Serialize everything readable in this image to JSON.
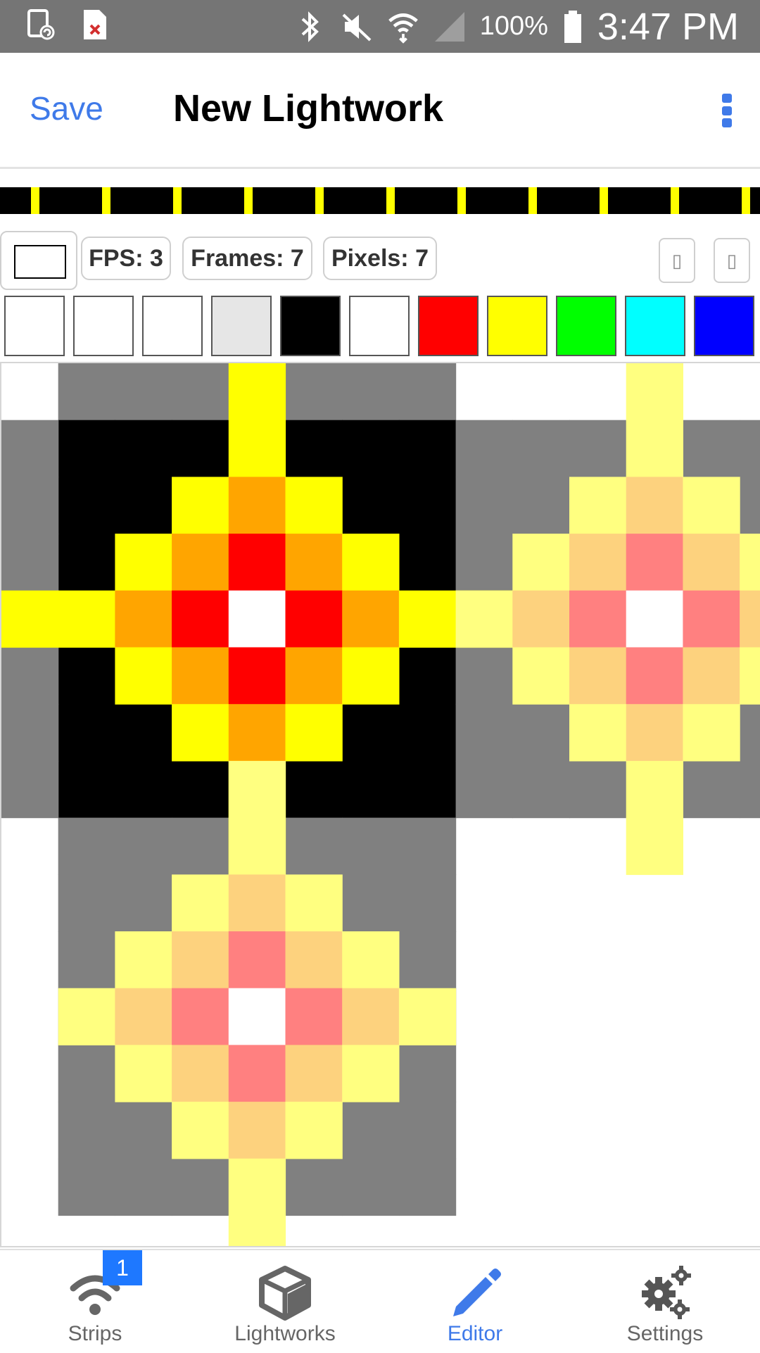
{
  "status_bar": {
    "battery": "100%",
    "time": "3:47 PM",
    "icons": [
      "screen-rotate-icon",
      "file-error-icon",
      "bluetooth-icon",
      "mute-icon",
      "wifi-icon",
      "signal-icon",
      "battery-icon"
    ]
  },
  "app_bar": {
    "save_label": "Save",
    "title": "New Lightwork",
    "menu_icon": "more-vert-icon"
  },
  "toolbar": {
    "fps_label": "FPS: 3",
    "frames_label": "Frames: 7",
    "pixels_label": "Pixels: 7",
    "current_color": "#ffffff",
    "tool_1_icon": "missing-glyph",
    "tool_2_icon": "missing-glyph"
  },
  "palette": [
    "#ffffff",
    "#ffffff",
    "#ffffff",
    "#e6e6e6",
    "#000000",
    "#ffffff",
    "#ff0000",
    "#ffff00",
    "#00ff00",
    "#00ffff",
    "#0000ff"
  ],
  "colors": {
    "accent": "#3f7ae9",
    "grid_background": "#808080",
    "active_frame_background": "#000000",
    "timeline_marker": "#ffff00",
    "badge": "#1e78ff"
  },
  "bottom_nav": {
    "items": [
      {
        "label": "Strips",
        "icon": "wifi-icon",
        "badge": "1",
        "active": false
      },
      {
        "label": "Lightworks",
        "icon": "cube-icon",
        "active": false
      },
      {
        "label": "Editor",
        "icon": "pencil-icon",
        "active": true
      },
      {
        "label": "Settings",
        "icon": "gears-icon",
        "active": false
      }
    ]
  }
}
